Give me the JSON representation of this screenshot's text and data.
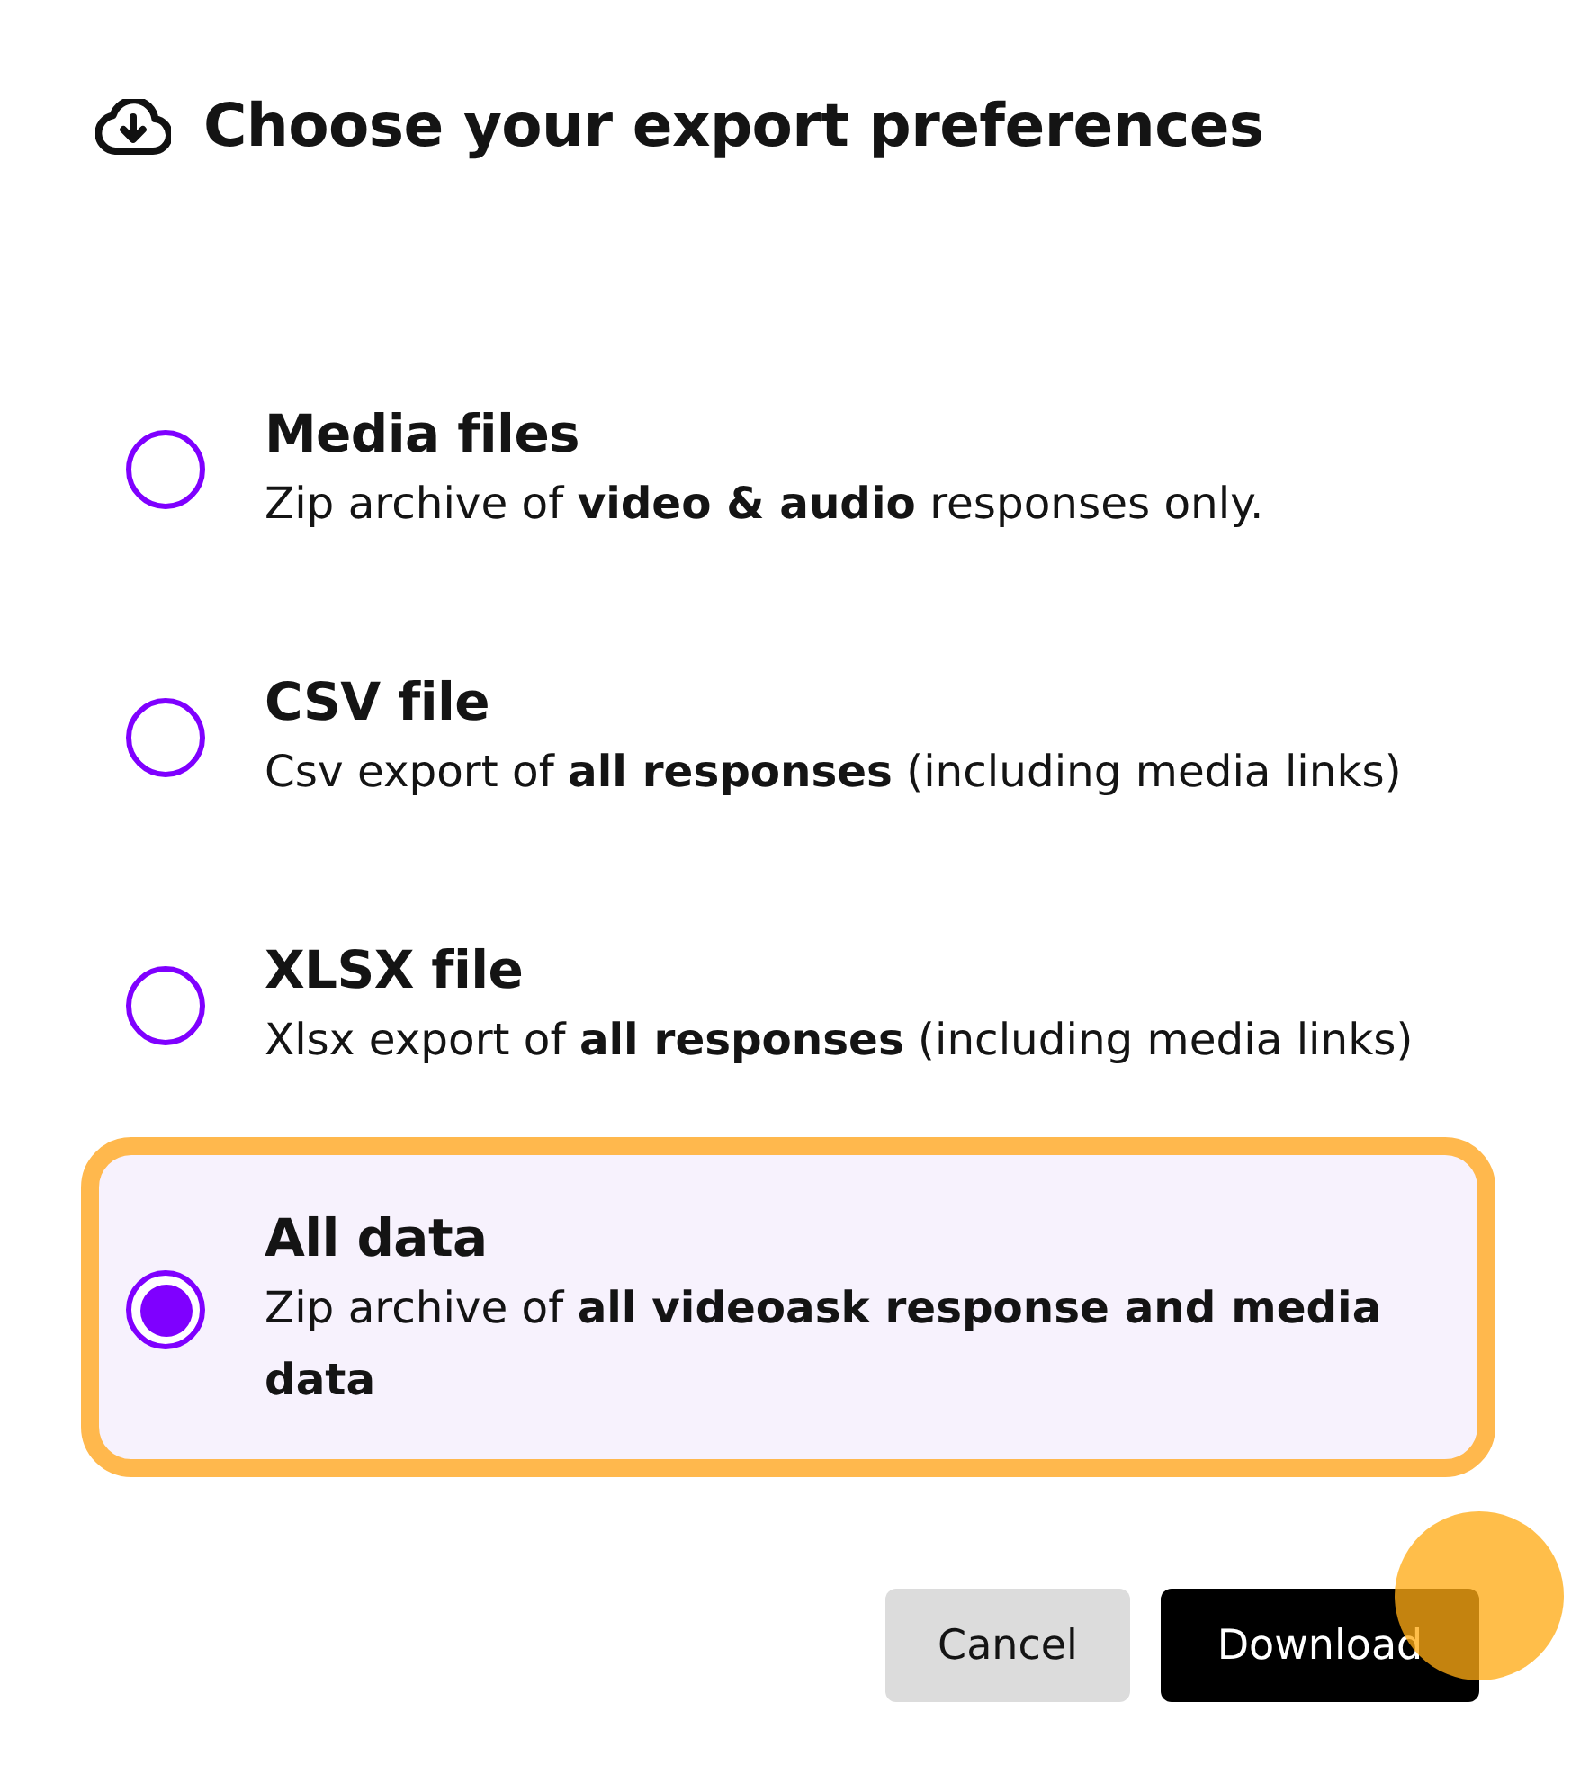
{
  "dialog": {
    "title": "Choose your export preferences"
  },
  "options": [
    {
      "title": "Media files",
      "description": "Zip archive of **video & audio** responses only.",
      "selected": false
    },
    {
      "title": "CSV file",
      "description": "Csv export of **all responses** (including media links)",
      "selected": false
    },
    {
      "title": "XLSX file",
      "description": "Xlsx export of **all responses** (including media links)",
      "selected": false
    },
    {
      "title": "All data",
      "description": "Zip archive of **all videoask response and media data**",
      "selected": true
    }
  ],
  "buttons": [
    {
      "label": "Cancel",
      "kind": "secondary"
    },
    {
      "label": "Download",
      "kind": "primary"
    }
  ]
}
